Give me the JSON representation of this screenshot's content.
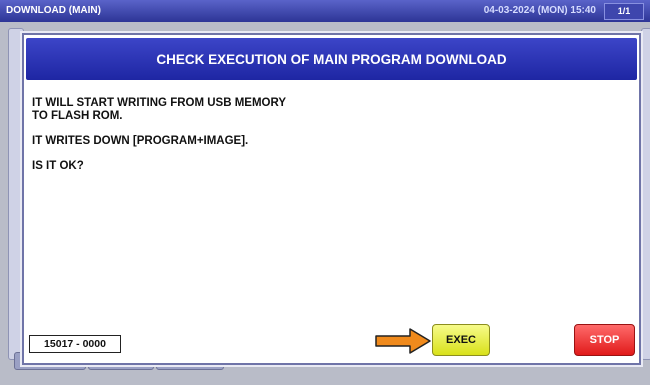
{
  "topbar": {
    "title": "DOWNLOAD (MAIN)",
    "datetime": "04-03-2024 (MON) 15:40",
    "page_indicator": "1/1"
  },
  "dialog": {
    "title": "CHECK EXECUTION OF MAIN PROGRAM DOWNLOAD",
    "line1a": "IT WILL START WRITING FROM USB MEMORY",
    "line1b": "TO FLASH ROM.",
    "line2": "IT WRITES DOWN [PROGRAM+IMAGE].",
    "line3": "IS IT OK?",
    "code": "15017 - 0000",
    "exec_label": "EXEC",
    "stop_label": "STOP"
  },
  "colors": {
    "header": "#2a32b8",
    "exec_button": "#e6ec3a",
    "stop_button": "#f03030",
    "arrow": "#f08a1c"
  },
  "icons": {
    "pointer": "arrow-right-icon"
  }
}
